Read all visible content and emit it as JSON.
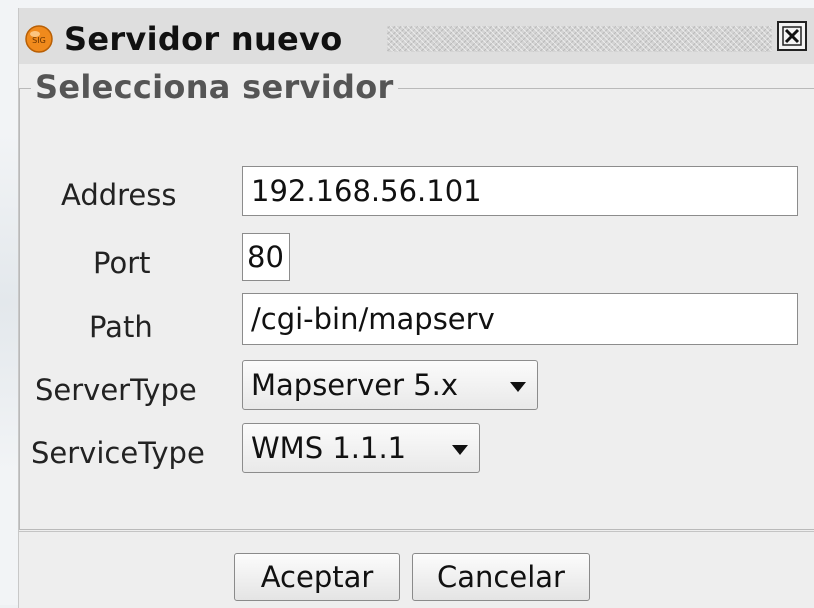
{
  "window": {
    "title": "Servidor nuevo",
    "app_icon": "sig-logo-icon",
    "close_icon": "close-icon"
  },
  "group": {
    "title": "Selecciona servidor"
  },
  "form": {
    "address": {
      "label": "Address",
      "value": "192.168.56.101"
    },
    "port": {
      "label": "Port",
      "value": "80"
    },
    "path": {
      "label": "Path",
      "value": "/cgi-bin/mapserv"
    },
    "server_type": {
      "label": "ServerType",
      "selected": "Mapserver 5.x"
    },
    "service_type": {
      "label": "ServiceType",
      "selected": "WMS 1.1.1"
    }
  },
  "buttons": {
    "accept": "Aceptar",
    "cancel": "Cancelar"
  },
  "colors": {
    "icon_orange": "#f08a1c",
    "dialog_bg": "#eeeeee"
  }
}
